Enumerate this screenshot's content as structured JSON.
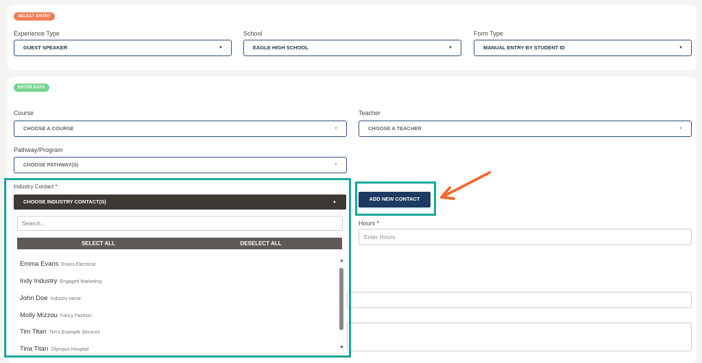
{
  "select_entry": {
    "badge": "SELECT ENTRY",
    "experience_type": {
      "label": "Experience Type",
      "value": "GUEST SPEAKER"
    },
    "school": {
      "label": "School",
      "value": "EAGLE HIGH SCHOOL"
    },
    "form_type": {
      "label": "Form Type",
      "value": "MANUAL ENTRY BY STUDENT ID"
    }
  },
  "enter_data": {
    "badge": "ENTER DATA",
    "course": {
      "label": "Course",
      "placeholder": "CHOOSE A COURSE"
    },
    "teacher": {
      "label": "Teacher",
      "placeholder": "CHOOSE A TEACHER"
    },
    "pathway": {
      "label": "Pathway/Program",
      "placeholder": "CHOOSE PATHWAY(S)"
    },
    "industry_contact": {
      "label": "Industry Contact *",
      "placeholder": "CHOOSE INDUSTRY CONTACT(S)"
    },
    "add_contact_label": "ADD NEW CONTACT",
    "hours": {
      "label": "Hours *",
      "placeholder": "Enter Hours"
    }
  },
  "dropdown": {
    "search_placeholder": "Search...",
    "select_all": "SELECT ALL",
    "deselect_all": "DESELECT ALL",
    "items": [
      {
        "name": "Emma Evans",
        "org": "Evans Electrical"
      },
      {
        "name": "Indy Industry",
        "org": "Engaged Marketing"
      },
      {
        "name": "John Doe",
        "org": "Industry name"
      },
      {
        "name": "Molly Mizzou",
        "org": "Fancy Fashion"
      },
      {
        "name": "Tim Titan",
        "org": "Tim's Example Services"
      },
      {
        "name": "Tina Titan",
        "org": "Olympus Hospital"
      }
    ]
  },
  "colors": {
    "select_badge": "#ef7d55",
    "enter_badge": "#77d38d",
    "highlight": "#17a79b",
    "arrow": "#f26a2e",
    "primary": "#1d3b62"
  }
}
